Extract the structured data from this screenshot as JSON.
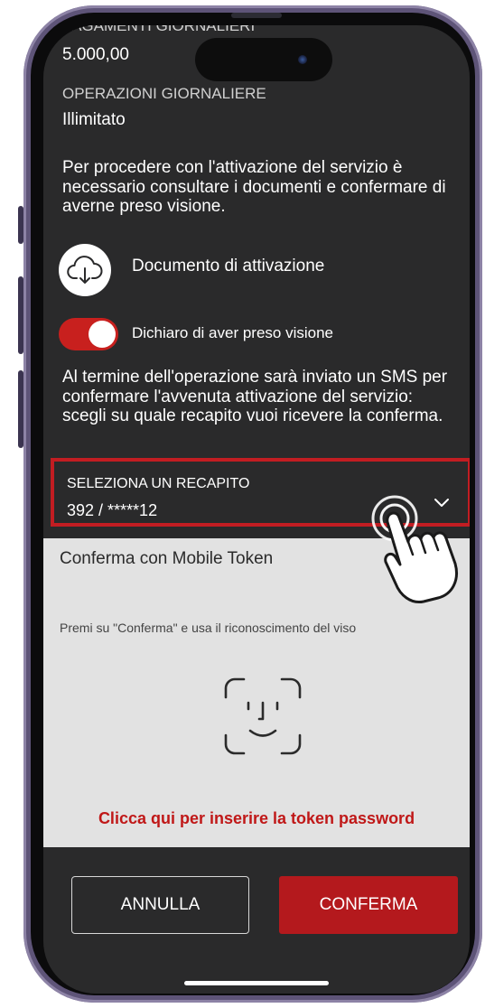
{
  "screen": {
    "cut_label": "PAGAMENTI GIORNALIERI",
    "cut_value": "5.000,00",
    "operations_label": "OPERAZIONI GIORNALIERE",
    "operations_value": "Illimitato",
    "intro_text": "Per procedere con l'attivazione del servizio è necessario consultare i documenti e confermare di averne preso visione.",
    "document_label": "Documento di attivazione",
    "consent_label": "Dichiaro di aver preso visione",
    "consent_checked": true,
    "sms_text": "Al termine dell'operazione sarà inviato un SMS per confermare l'avvenuta attivazione del servizio: scegli su quale recapito vuoi ricevere la conferma.",
    "recipient": {
      "label": "SELEZIONA UN RECAPITO",
      "value": "392 / *****12"
    }
  },
  "token": {
    "title": "Conferma con Mobile Token",
    "hint": "Premi su \"Conferma\" e usa il riconoscimento del viso",
    "password_link": "Clicca qui per inserire la token password"
  },
  "buttons": {
    "cancel": "ANNULLA",
    "confirm": "CONFERMA"
  },
  "colors": {
    "accent_red": "#c21d22",
    "screen_bg": "#2a2a2b",
    "panel_bg": "#e2e2e2",
    "link_red": "#c01818"
  },
  "icons": [
    "cloud-download-icon",
    "chevron-down-icon",
    "face-id-icon",
    "pointing-hand-icon"
  ]
}
